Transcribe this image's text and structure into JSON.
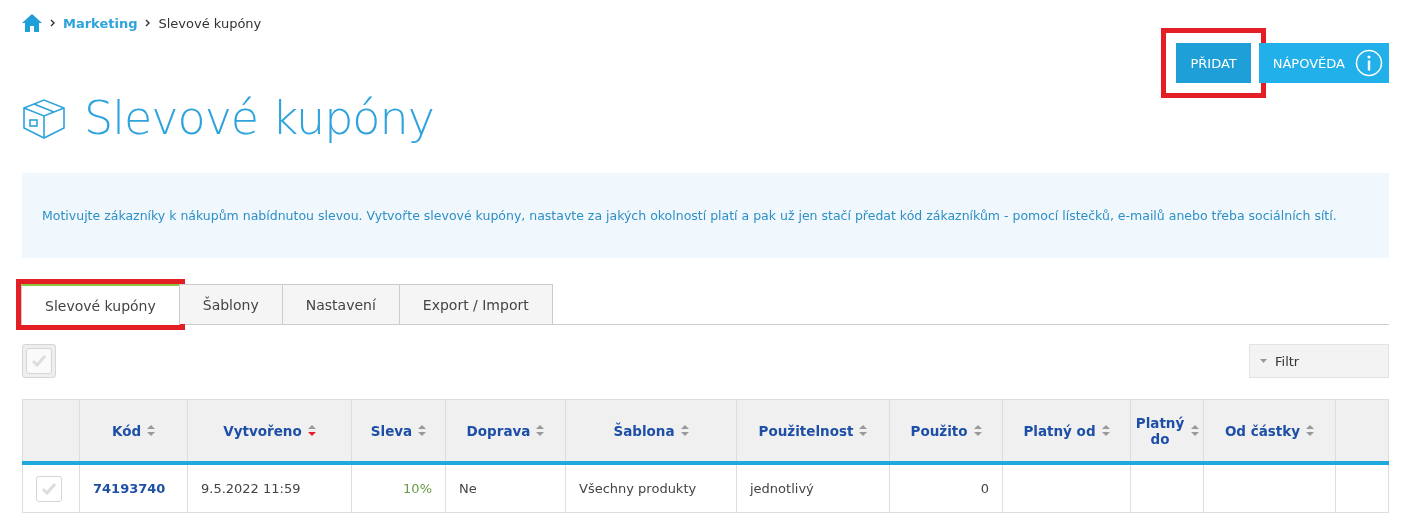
{
  "breadcrumb": [
    {
      "label": "Marketing",
      "link": true
    },
    {
      "label": "Slevové kupóny",
      "link": false
    }
  ],
  "buttons": [
    {
      "label": "PŘIDAT",
      "kind": "primary",
      "highlighted": true
    },
    {
      "label": "NÁPOVĚDA",
      "kind": "help",
      "highlighted": false
    }
  ],
  "title": "Slevové kupóny",
  "info": "Motivujte zákazníky k nákupům nabídnutou slevou. Vytvořte slevové kupóny, nastavte za jakých okolností platí a pak už jen stačí předat kód zákazníkům - pomocí lístečků, e-mailů anebo třeba sociálních sítí.",
  "tabs": [
    {
      "label": "Slevové kupóny",
      "selected": true,
      "highlighted": true
    },
    {
      "label": "Šablony",
      "selected": false,
      "highlighted": false
    },
    {
      "label": "Nastavení",
      "selected": false,
      "highlighted": false
    },
    {
      "label": "Export / Import",
      "selected": false,
      "highlighted": false
    }
  ],
  "select_all": {
    "checked": false
  },
  "filter": {
    "label": "Filtr"
  },
  "table": {
    "columns": [
      {
        "label": "Kód",
        "sorted": false
      },
      {
        "label": "Vytvořeno",
        "sorted": true
      },
      {
        "label": "Sleva",
        "sorted": false
      },
      {
        "label": "Doprava",
        "sorted": false
      },
      {
        "label": "Šablona",
        "sorted": false
      },
      {
        "label": "Použitelnost",
        "sorted": false
      },
      {
        "label": "Použito",
        "sorted": false
      },
      {
        "label": "Platný od",
        "sorted": false
      },
      {
        "label": "Platný do",
        "sorted": false
      },
      {
        "label": "Od částky",
        "sorted": false
      }
    ],
    "rows": [
      {
        "checked": false,
        "cells": [
          "74193740",
          "9.5.2022 11:59",
          "10%",
          "Ne",
          "Všechny produkty",
          "jednotlivý",
          "0",
          "",
          "",
          ""
        ]
      }
    ]
  }
}
